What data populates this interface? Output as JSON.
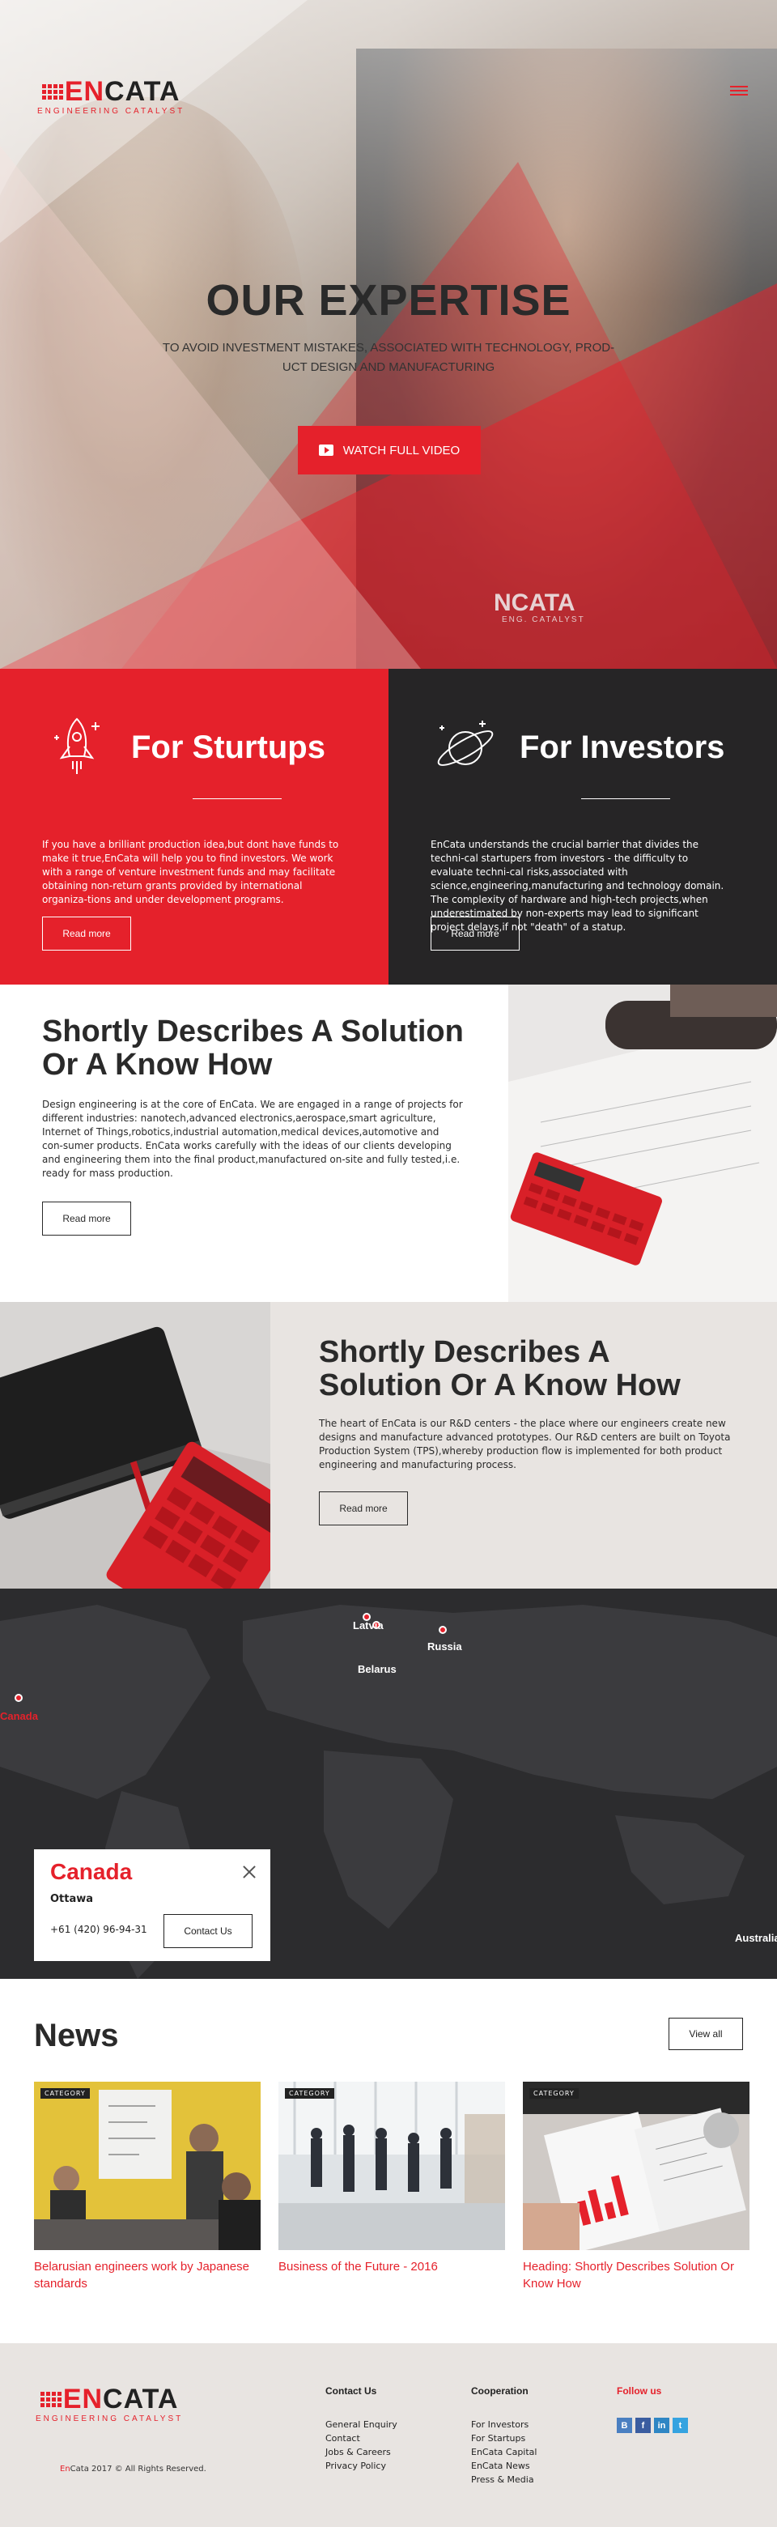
{
  "brand": {
    "name_prefix": "EN",
    "name_rest": "CATA",
    "tagline": "ENGINEERING CATALYST",
    "accent": "#e5212b",
    "dark": "#262526"
  },
  "hero": {
    "title": "OUR EXPERTISE",
    "subtitle": "TO AVOID INVESTMENT MISTAKES, ASSOCIATED WITH TECHNOLOGY, PROD-UCT DESIGN AND MANUFACTURING",
    "video_button": "WATCH FULL VIDEO",
    "shirt_logo": "NCATA",
    "shirt_tag": "ENG. CATALYST"
  },
  "startups": {
    "icon": "rocket-icon",
    "title": "For Sturtups",
    "text": "If you have a brilliant production idea,but dont have funds to make it true,EnCata will help you to find investors. We work with a range of venture investment funds and may facilitate obtaining non-return grants provided by international organiza-tions and under development programs.",
    "button": "Read more"
  },
  "investors": {
    "icon": "planet-icon",
    "title": "For Investors",
    "text": "EnCata understands the crucial barrier that divides the techni-cal startupers from investors - the difficulty to evaluate techni-cal risks,associated with science,engineering,manufacturing and technology domain. The complexity of hardware and high-tech projects,when underestimated by non-experts may lead to significant project delays,if not \"death\" of a statup.",
    "button": "Read more"
  },
  "describe1": {
    "title": "Shortly Describes A Solution Or A Know How",
    "text": "Design engineering is at the core of EnCata. We are engaged in a range of projects for different industries: nanotech,advanced electronics,aerospace,smart agriculture, Internet of Things,robotics,industrial automation,medical devices,automotive and con-sumer products. EnCata works carefully with the ideas of our clients developing and engineering them into the final product,manufactured on-site and fully tested,i.e. ready for mass production.",
    "button": "Read more"
  },
  "describe2": {
    "title": "Shortly Describes A Solution Or A Know How",
    "text": "The heart of EnCata is our R&D centers  - the place where our engineers create new designs and manufacture advanced prototypes. Our R&D centers are built on Toyota Production System (TPS),whereby production flow is implemented for both product engineering and manufacturing process.",
    "button": "Read more"
  },
  "map": {
    "labels": {
      "latvia": "Latvia",
      "russia": "Russia",
      "belarus": "Belarus",
      "canada": "Canada",
      "australia": "Australia"
    },
    "card": {
      "country": "Canada",
      "city": "Ottawa",
      "phone": "+61 (420) 96-94-31",
      "button": "Contact Us"
    }
  },
  "news": {
    "title": "News",
    "view_all": "View all",
    "items": [
      {
        "category": "CATEGORY",
        "title": "Belarusian engineers work by Japanese standards"
      },
      {
        "category": "CATEGORY",
        "title": "Business of the Future - 2016"
      },
      {
        "category": "CATEGORY",
        "title": "Heading: Shortly Describes Solution Or Know How"
      }
    ]
  },
  "footer": {
    "copyright_prefix": "En",
    "copyright_rest": "Cata 2017 © All Rights Reserved.",
    "contact": {
      "title": "Contact Us",
      "links": [
        "General Enquiry",
        "Contact",
        "Jobs & Careers",
        "Privacy Policy"
      ]
    },
    "cooperation": {
      "title": "Cooperation",
      "links": [
        "For Investors",
        "For Startups",
        "EnCata Capital",
        "EnCata News",
        "Press & Media"
      ]
    },
    "follow": {
      "title": "Follow us",
      "networks": [
        {
          "icon": "behance-icon",
          "glyph": "B",
          "color": "#4a7fc1"
        },
        {
          "icon": "facebook-icon",
          "glyph": "f",
          "color": "#3b5da0"
        },
        {
          "icon": "linkedin-icon",
          "glyph": "in",
          "color": "#2f86c4"
        },
        {
          "icon": "twitter-icon",
          "glyph": "t",
          "color": "#36a3e0"
        }
      ]
    }
  }
}
